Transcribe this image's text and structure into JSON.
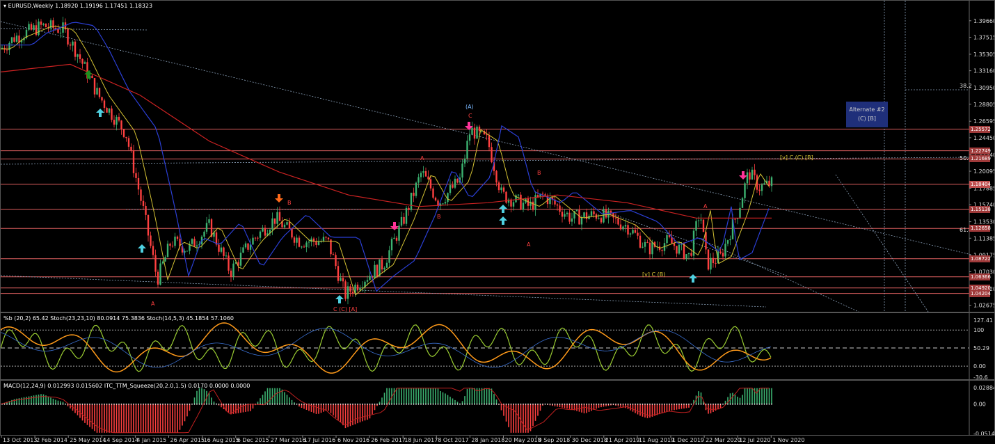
{
  "chart_header": {
    "symbol": "EURUSD,Weekly",
    "ohlc": "1.18920 1.19196 1.17451 1.18323"
  },
  "colors": {
    "background": "#000000",
    "bull": "#3cb371",
    "bear": "#ff4040",
    "ma_yellow": "#d4c233",
    "ma_blue": "#2b3fd6",
    "ma_red": "#cc2222",
    "fib_line": "#e06060",
    "cyan_arrow": "#4fd0e0",
    "magenta_arrow": "#ff3399",
    "orange_arrow": "#ff6a1a",
    "green_arrow": "#1e8f1e",
    "stoch_green": "#9acd32",
    "stoch_orange": "#ff9a1a",
    "alt_box_bg": "#1f2f7a"
  },
  "alternate_box": {
    "title": "Alternate #2",
    "label": "(C) [B]"
  },
  "price_axis": [
    "1.39660",
    "1.37515",
    "1.35305",
    "1.33160",
    "1.30950",
    "1.28805",
    "1.26595",
    "1.24450",
    "1.22240",
    "1.20095",
    "1.17885",
    "1.15740",
    "1.13530",
    "1.11385",
    "1.09175",
    "1.07030",
    "1.04820",
    "1.02675"
  ],
  "level_tags": [
    {
      "label": "1.25572",
      "price": 1.2557
    },
    {
      "label": "1.22749",
      "price": 1.2275
    },
    {
      "label": "1.21689",
      "price": 1.2169
    },
    {
      "label": "1.18404",
      "price": 1.184
    },
    {
      "label": "1.15138",
      "price": 1.1514
    },
    {
      "label": "1.12658",
      "price": 1.1266
    },
    {
      "label": "1.08722",
      "price": 1.0872
    },
    {
      "label": "1.06366",
      "price": 1.0637
    },
    {
      "label": "1.04920",
      "price": 1.0492
    },
    {
      "label": "1.04204",
      "price": 1.042
    }
  ],
  "current_price_tag": {
    "label": "1.18404"
  },
  "fib_text": {
    "level1": "38.2",
    "level2": "50.0",
    "level3": "61.8"
  },
  "wave_labels": [
    {
      "t": "A",
      "x": 216,
      "y": 438,
      "c": "#ff4040"
    },
    {
      "t": "C (C) [A]",
      "x": 478,
      "y": 446,
      "c": "#ff4040"
    },
    {
      "t": "B",
      "x": 412,
      "y": 293,
      "c": "#ff4040"
    },
    {
      "t": "(A)",
      "x": 668,
      "y": 155,
      "c": "#7ab8ff"
    },
    {
      "t": "C",
      "x": 672,
      "y": 168,
      "c": "#ff4040"
    },
    {
      "t": "A",
      "x": 603,
      "y": 229,
      "c": "#ff4040"
    },
    {
      "t": "B",
      "x": 627,
      "y": 313,
      "c": "#ff4040"
    },
    {
      "t": "B",
      "x": 771,
      "y": 250,
      "c": "#ff4040"
    },
    {
      "t": "A",
      "x": 756,
      "y": 353,
      "c": "#ff4040"
    },
    {
      "t": "[v] C (B)",
      "x": 922,
      "y": 396,
      "c": "#d4c233"
    },
    {
      "t": "A",
      "x": 1010,
      "y": 298,
      "c": "#ff4040"
    },
    {
      "t": "[v] C (C) [B]",
      "x": 1120,
      "y": 228,
      "c": "#d4c233"
    }
  ],
  "time_axis": [
    "13 Oct 2013",
    "2 Feb 2014",
    "25 May 2014",
    "14 Sep 2014",
    "4 Jan 2015",
    "26 Apr 2015",
    "16 Aug 2015",
    "6 Dec 2015",
    "27 Mar 2016",
    "17 Jul 2016",
    "6 Nov 2016",
    "26 Feb 2017",
    "18 Jun 2017",
    "8 Oct 2017",
    "28 Jan 2018",
    "20 May 2018",
    "9 Sep 2018",
    "30 Dec 2018",
    "21 Apr 2019",
    "11 Aug 2019",
    "1 Dec 2019",
    "22 Mar 2020",
    "12 Jul 2020",
    "1 Nov 2020"
  ],
  "stoch_panel": {
    "header": "%b (20,2) 65.42  Stoch(23,23,10) 80.0914 75.3836  Stoch(14,5,3) 45.1854 57.1060",
    "axis": [
      "127.41",
      "100",
      "50.29",
      "0.00",
      "-30.6"
    ]
  },
  "macd_panel": {
    "header": "MACD(12,24,9) 0.012993 0.015602  ITC_TTM_Squeeze(20,2.0,1.5) 0.0170 0.0000 0.0000",
    "axis": [
      "0.028847",
      "0.00",
      "-0.051419"
    ]
  },
  "chart_data": {
    "type": "line",
    "title": "EURUSD,Weekly",
    "x": [
      "13 Oct 2013",
      "2 Feb 2014",
      "25 May 2014",
      "14 Sep 2014",
      "4 Jan 2015",
      "26 Apr 2015",
      "16 Aug 2015",
      "6 Dec 2015",
      "27 Mar 2016",
      "17 Jul 2016",
      "6 Nov 2016",
      "26 Feb 2017",
      "18 Jun 2017",
      "8 Oct 2017",
      "28 Jan 2018",
      "20 May 2018",
      "9 Sep 2018",
      "30 Dec 2018",
      "21 Apr 2019",
      "11 Aug 2019",
      "1 Dec 2019",
      "22 Mar 2020",
      "12 Jul 2020",
      "1 Nov 2020"
    ],
    "series": [
      {
        "name": "EURUSD",
        "values": [
          1.365,
          1.385,
          1.36,
          1.29,
          1.16,
          1.12,
          1.12,
          1.09,
          1.13,
          1.11,
          1.06,
          1.06,
          1.14,
          1.18,
          1.24,
          1.17,
          1.16,
          1.14,
          1.13,
          1.11,
          1.11,
          1.09,
          1.17,
          1.18
        ]
      }
    ],
    "ylim": [
      1.02,
      1.41
    ],
    "ylabel": "",
    "xlabel": ""
  }
}
